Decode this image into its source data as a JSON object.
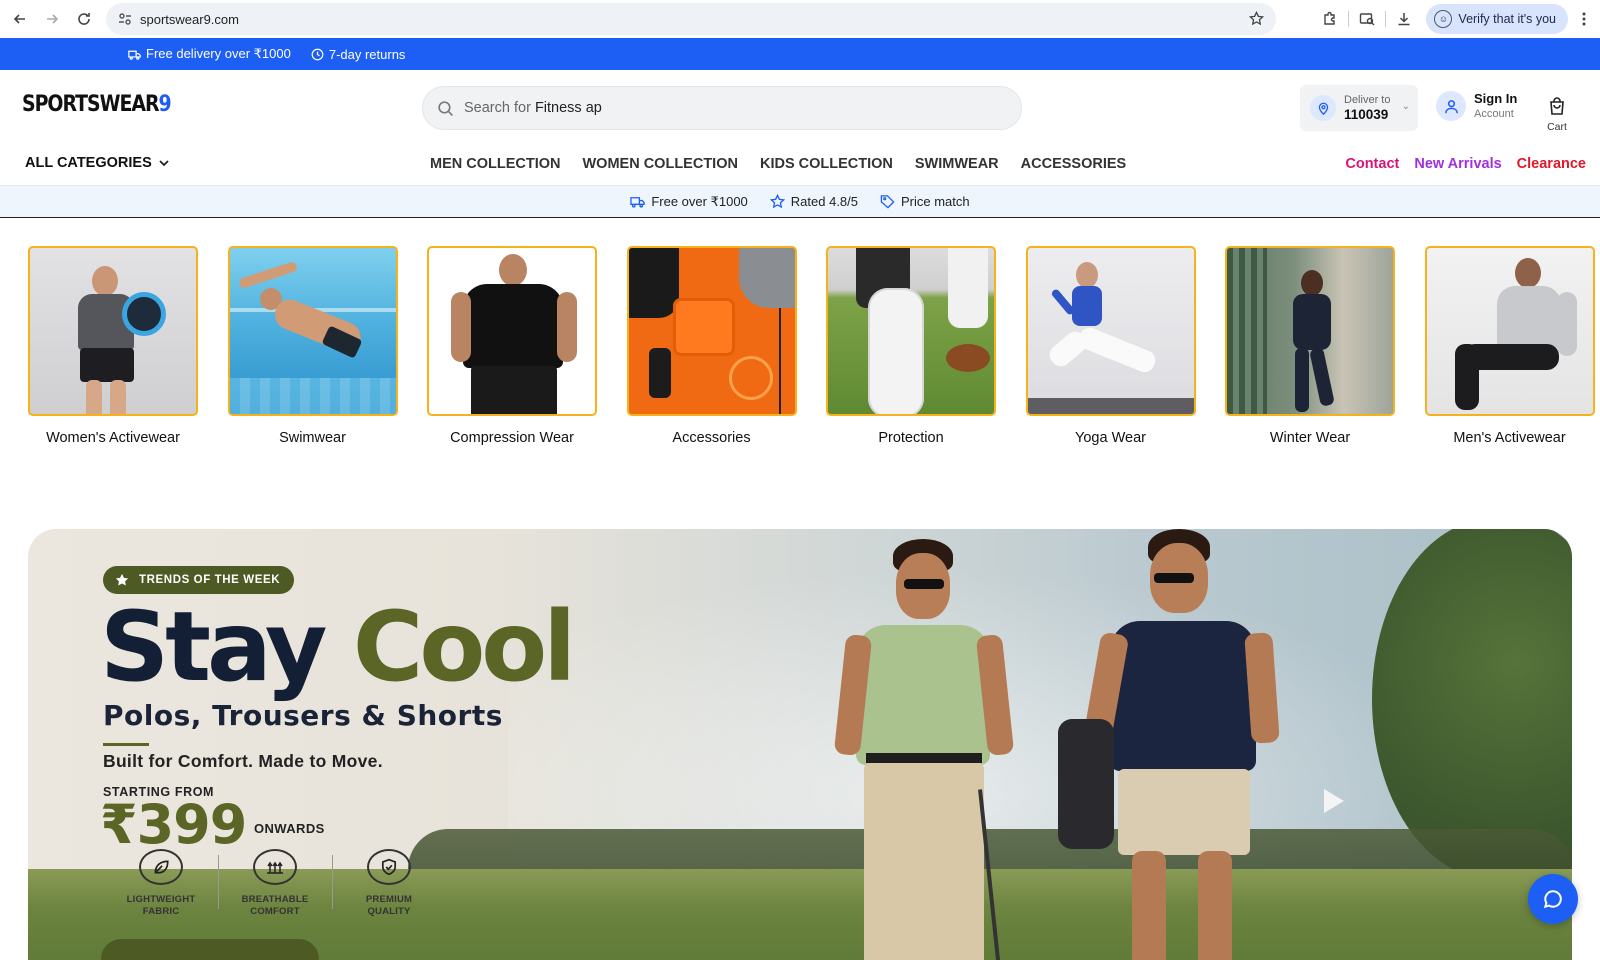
{
  "browser": {
    "url": "sportswear9.com",
    "verify_label": "Verify that it's you"
  },
  "announcement": {
    "delivery": "Free delivery over ₹1000",
    "returns": "7-day returns"
  },
  "header": {
    "logo_main": "SPORTSWEAR",
    "logo_accent": "9",
    "search_placeholder": "Search for",
    "search_typed": "Fitness ap",
    "deliver_label": "Deliver to",
    "deliver_pincode": "110039",
    "signin_label": "Sign In",
    "account_label": "Account",
    "cart_label": "Cart"
  },
  "catnav": {
    "all_categories": "ALL CATEGORIES",
    "main": [
      "MEN COLLECTION",
      "WOMEN COLLECTION",
      "KIDS COLLECTION",
      "SWIMWEAR",
      "ACCESSORIES"
    ],
    "right": [
      {
        "label": "Contact",
        "color": "#d6157a"
      },
      {
        "label": "New Arrivals",
        "color": "#a12fe0"
      },
      {
        "label": "Clearance",
        "color": "#e0182a"
      }
    ]
  },
  "trust": {
    "free": "Free over ₹1000",
    "rated": "Rated 4.8/5",
    "price": "Price match"
  },
  "categories": [
    {
      "name": "Women's Activewear",
      "bg": "#d9d9db",
      "accent": "#4a4a4e"
    },
    {
      "name": "Swimwear",
      "bg": "#5fb8e0",
      "accent": "#0f5e96"
    },
    {
      "name": "Compression Wear",
      "bg": "#ffffff",
      "accent": "#111111"
    },
    {
      "name": "Accessories",
      "bg": "#f06a14",
      "accent": "#222222"
    },
    {
      "name": "Protection",
      "bg": "#6f9a3a",
      "accent": "#f2f2f2"
    },
    {
      "name": "Yoga Wear",
      "bg": "#e9e9ec",
      "accent": "#2b4fb5"
    },
    {
      "name": "Winter Wear",
      "bg": "#6a7f6a",
      "accent": "#1f2838"
    },
    {
      "name": "Men's Activewear",
      "bg": "#eeeeee",
      "accent": "#222222"
    }
  ],
  "hero": {
    "badge": "TRENDS OF THE WEEK",
    "title_1": "Stay",
    "title_2": "Cool",
    "subtitle": "Polos, Trousers & Shorts",
    "tagline": "Built for Comfort. Made to Move.",
    "starting_from": "STARTING FROM",
    "price": "₹399",
    "onwards": "ONWARDS",
    "features": [
      {
        "line1": "LIGHTWEIGHT",
        "line2": "FABRIC",
        "icon": "leaf-icon"
      },
      {
        "line1": "BREATHABLE",
        "line2": "COMFORT",
        "icon": "airflow-icon"
      },
      {
        "line1": "PREMIUM",
        "line2": "QUALITY",
        "icon": "shield-icon"
      }
    ]
  }
}
